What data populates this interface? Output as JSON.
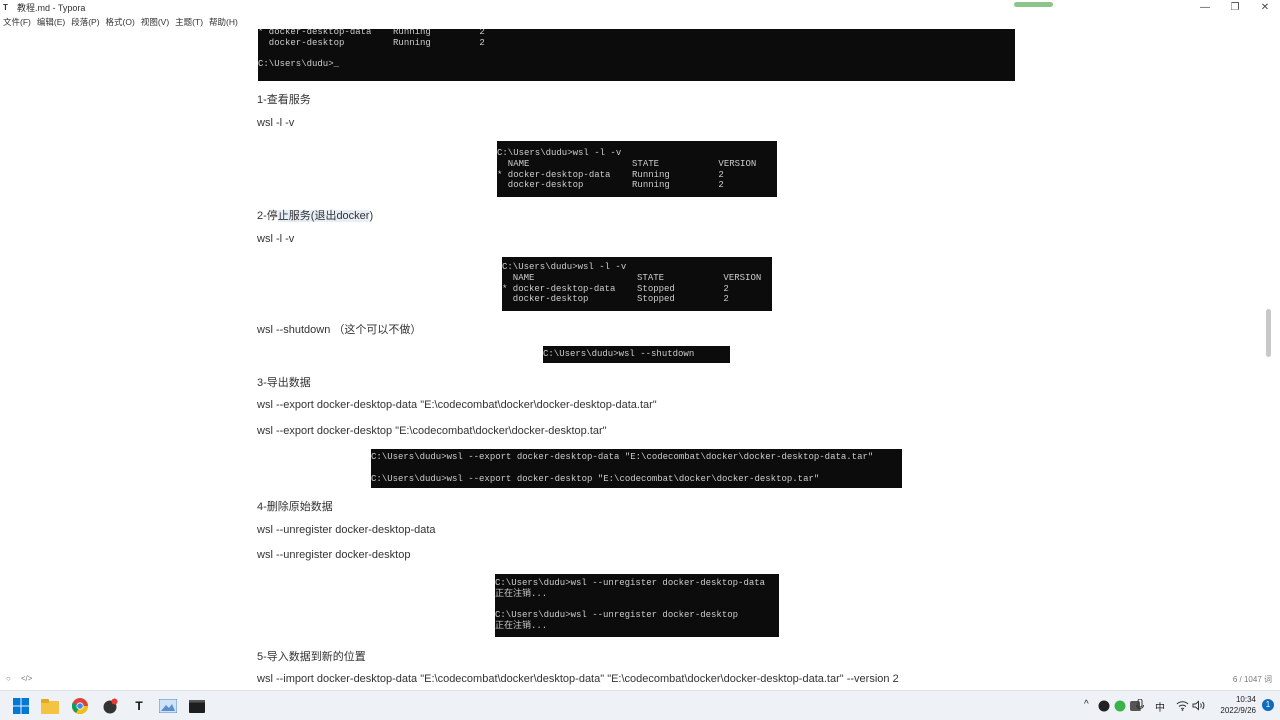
{
  "window": {
    "app_icon": "T",
    "title": "教程.md - Typora",
    "minimize": "—",
    "restore": "❐",
    "close": "✕"
  },
  "menu": [
    "文件(F)",
    "编辑(E)",
    "段落(P)",
    "格式(O)",
    "视图(V)",
    "主题(T)",
    "帮助(H)"
  ],
  "doc": {
    "term0": "* docker-desktop-data    Running         2\n  docker-desktop         Running         2\n\nC:\\Users\\dudu>_",
    "h1": "1-查看服务",
    "cmd1": "wsl -l -v",
    "term1": "C:\\Users\\dudu>wsl -l -v\n  NAME                   STATE           VERSION\n* docker-desktop-data    Running         2\n  docker-desktop         Running         2",
    "h2_prefix": "2-停",
    "h2_highlight": "止服务(退出docker",
    "h2_suffix": ")",
    "cmd2": "wsl -l -v",
    "term2": "C:\\Users\\dudu>wsl -l -v\n  NAME                   STATE           VERSION\n* docker-desktop-data    Stopped         2\n  docker-desktop         Stopped         2",
    "cmd3": "wsl --shutdown （这个可以不做）",
    "term3": "C:\\Users\\dudu>wsl --shutdown",
    "h3": "3-导出数据",
    "cmd4": "wsl --export docker-desktop-data \"E:\\codecombat\\docker\\docker-desktop-data.tar\"",
    "cmd5": "wsl --export docker-desktop \"E:\\codecombat\\docker\\docker-desktop.tar\"",
    "term4": "C:\\Users\\dudu>wsl --export docker-desktop-data \"E:\\codecombat\\docker\\docker-desktop-data.tar\"\n\nC:\\Users\\dudu>wsl --export docker-desktop \"E:\\codecombat\\docker\\docker-desktop.tar\"",
    "h4": "4-删除原始数据",
    "cmd6": "wsl --unregister docker-desktop-data",
    "cmd7": "wsl --unregister docker-desktop",
    "term5": "C:\\Users\\dudu>wsl --unregister docker-desktop-data\n正在注销...\n\nC:\\Users\\dudu>wsl --unregister docker-desktop\n正在注销...",
    "h5": "5-导入数据到新的位置",
    "cmd8": "wsl --import docker-desktop-data \"E:\\codecombat\\docker\\desktop-data\" \"E:\\codecombat\\docker\\docker-desktop-data.tar\" --version 2"
  },
  "status": {
    "left_icon": "○",
    "source_icon": "</>",
    "word_count": "6 / 1047 词"
  },
  "taskbar": {
    "icons": [
      "windows-start-icon",
      "file-explorer-icon",
      "chrome-icon",
      "app-icon",
      "typora-icon",
      "photos-icon",
      "terminal-icon"
    ],
    "tray": {
      "chevron": "^",
      "ime": "中",
      "volume": "🔊"
    },
    "time": "10:34",
    "date": "2022/9/26",
    "notifications": "1"
  }
}
